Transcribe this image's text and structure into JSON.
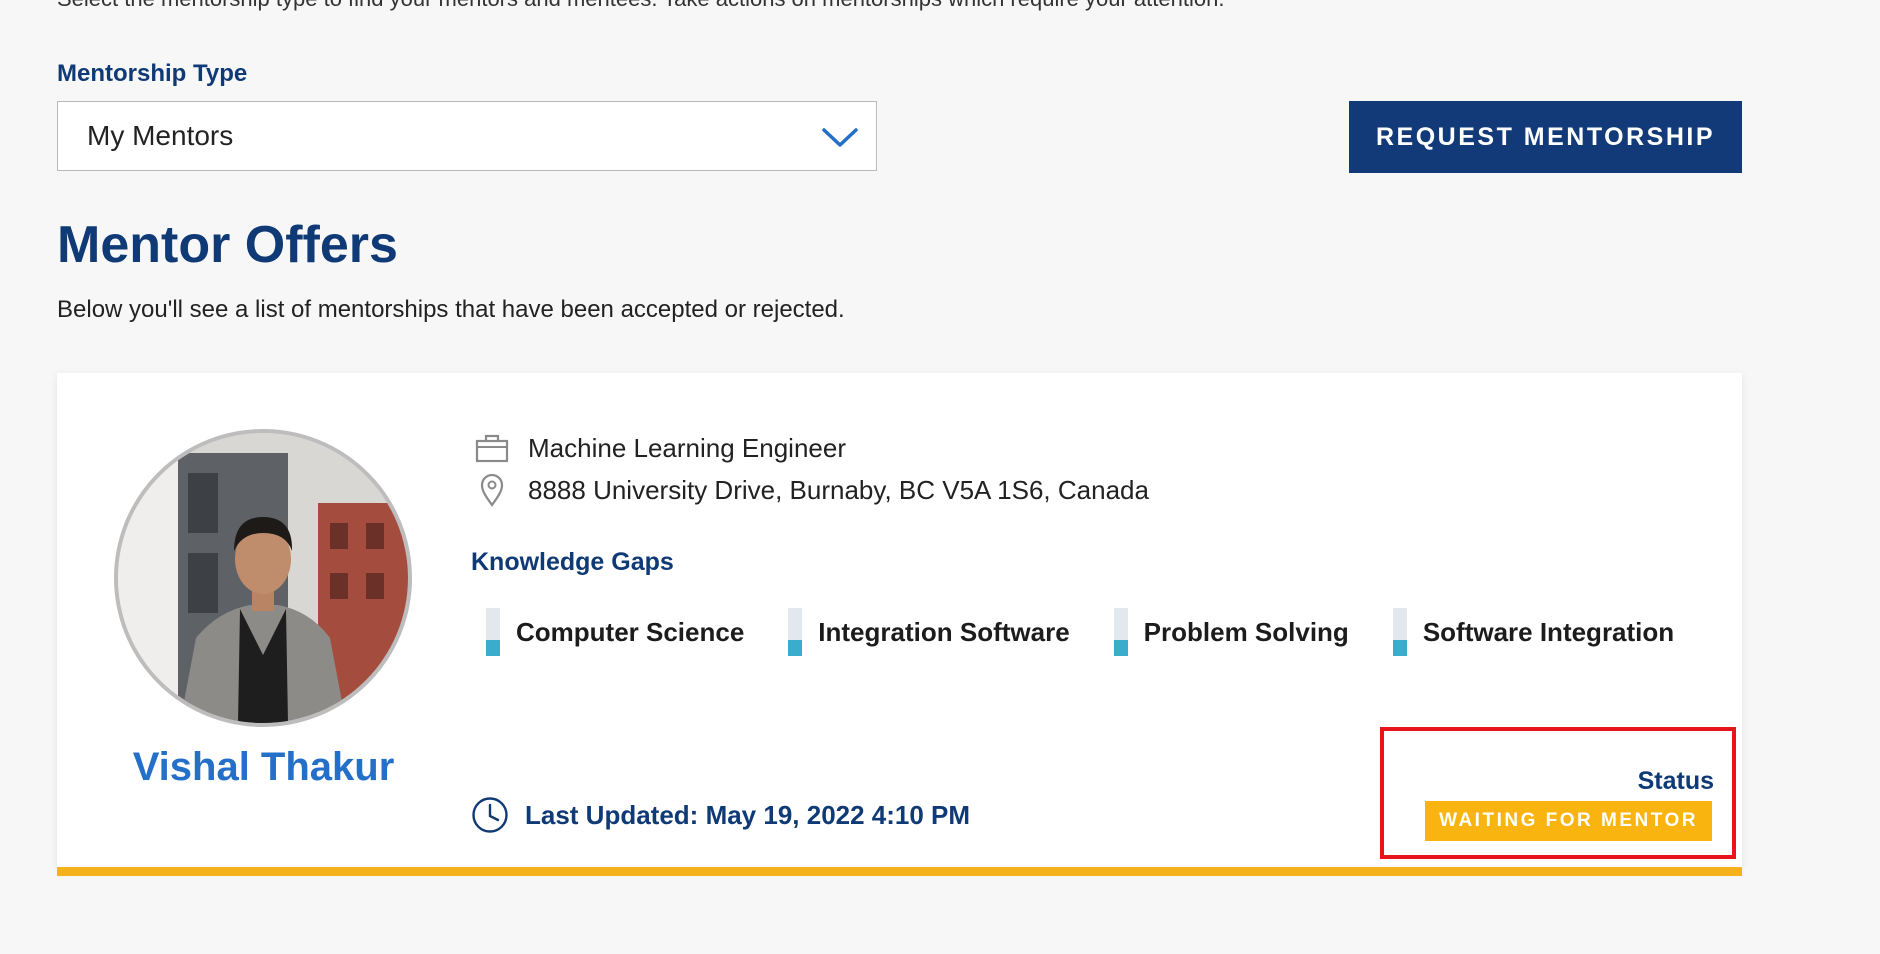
{
  "intro": {
    "text": "Select the mentorship type to find your mentors and mentees. Take actions on mentorships which require your attention."
  },
  "filter": {
    "label": "Mentorship Type",
    "selected": "My Mentors",
    "icon": "chevron-down-icon"
  },
  "actions": {
    "request_label": "REQUEST MENTORSHIP"
  },
  "section": {
    "title": "Mentor Offers",
    "description": "Below you'll see a list of mentorships that have been accepted or rejected."
  },
  "mentor": {
    "name": "Vishal Thakur",
    "job_title": "Machine Learning Engineer",
    "location": "8888 University Drive, Burnaby, BC V5A 1S6, Canada",
    "knowledge_gaps_label": "Knowledge Gaps",
    "knowledge_gaps": [
      {
        "label": "Computer Science",
        "level": 0.33
      },
      {
        "label": "Integration Software",
        "level": 0.33
      },
      {
        "label": "Problem Solving",
        "level": 0.33
      },
      {
        "label": "Software Integration",
        "level": 0.33
      }
    ],
    "last_updated": "Last Updated: May 19, 2022 4:10 PM",
    "status_label": "Status",
    "status_value": "WAITING FOR MENTOR"
  },
  "colors": {
    "brand_navy": "#123a78",
    "link_blue": "#2470c8",
    "accent_yellow": "#f5b21a",
    "gap_fill": "#3aaccc",
    "highlight_red": "#e8141c"
  }
}
